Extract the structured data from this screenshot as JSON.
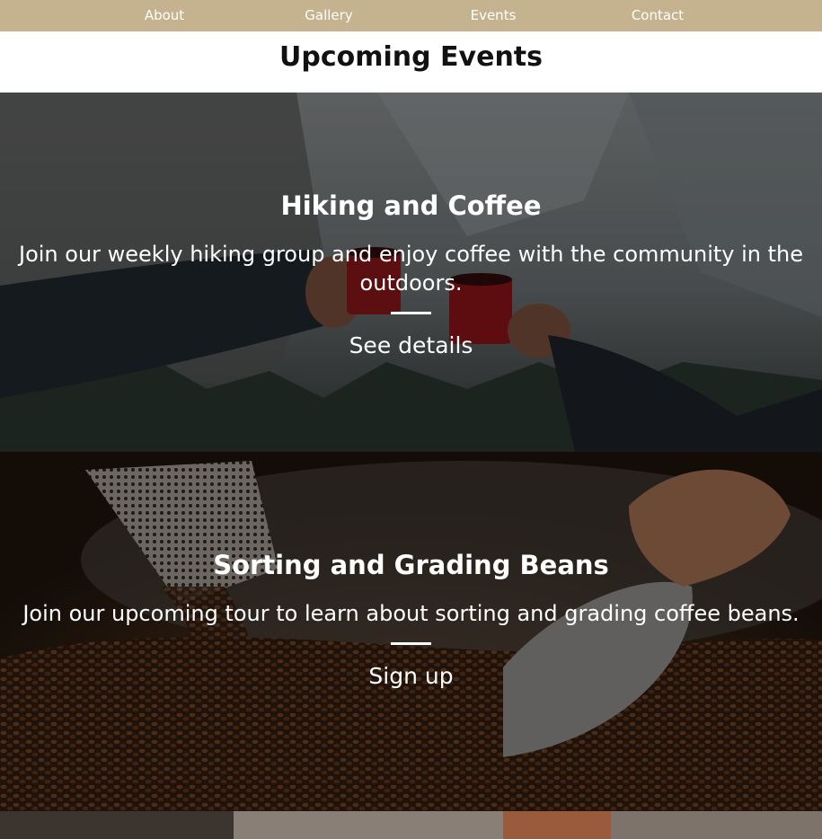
{
  "nav": {
    "items": [
      {
        "label": "About"
      },
      {
        "label": "Gallery"
      },
      {
        "label": "Events"
      },
      {
        "label": "Contact"
      }
    ],
    "background": "#c5b38f"
  },
  "page": {
    "title": "Upcoming Events"
  },
  "events": [
    {
      "title": "Hiking and Coffee",
      "description": "Join our weekly hiking group and enjoy coffee with the community in the outdoors.",
      "cta": "See details"
    },
    {
      "title": "Sorting and Grading Beans",
      "description": "Join our upcoming tour to learn about sorting and grading coffee beans.",
      "cta": "Sign up"
    }
  ]
}
